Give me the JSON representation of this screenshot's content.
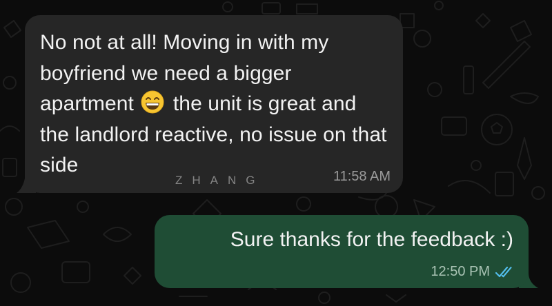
{
  "messages": [
    {
      "direction": "incoming",
      "text_before_emoji": "No not at all! Moving in with my boyfriend we need a bigger apartment",
      "emoji": "grinning-face-with-smiling-eyes",
      "text_after_emoji": "the unit is great and the landlord reactive, no issue on that side",
      "time": "11:58 AM"
    },
    {
      "direction": "outgoing",
      "text": "Sure thanks for the feedback :)",
      "time": "12:50 PM",
      "status": "read"
    }
  ],
  "watermark": "ZHANG",
  "colors": {
    "background": "#0c0c0c",
    "incoming_bubble": "#262626",
    "outgoing_bubble": "#1f4d35",
    "read_ticks": "#53bdeb"
  },
  "icons": [
    "read-receipt-icon",
    "grinning-emoji-icon"
  ]
}
